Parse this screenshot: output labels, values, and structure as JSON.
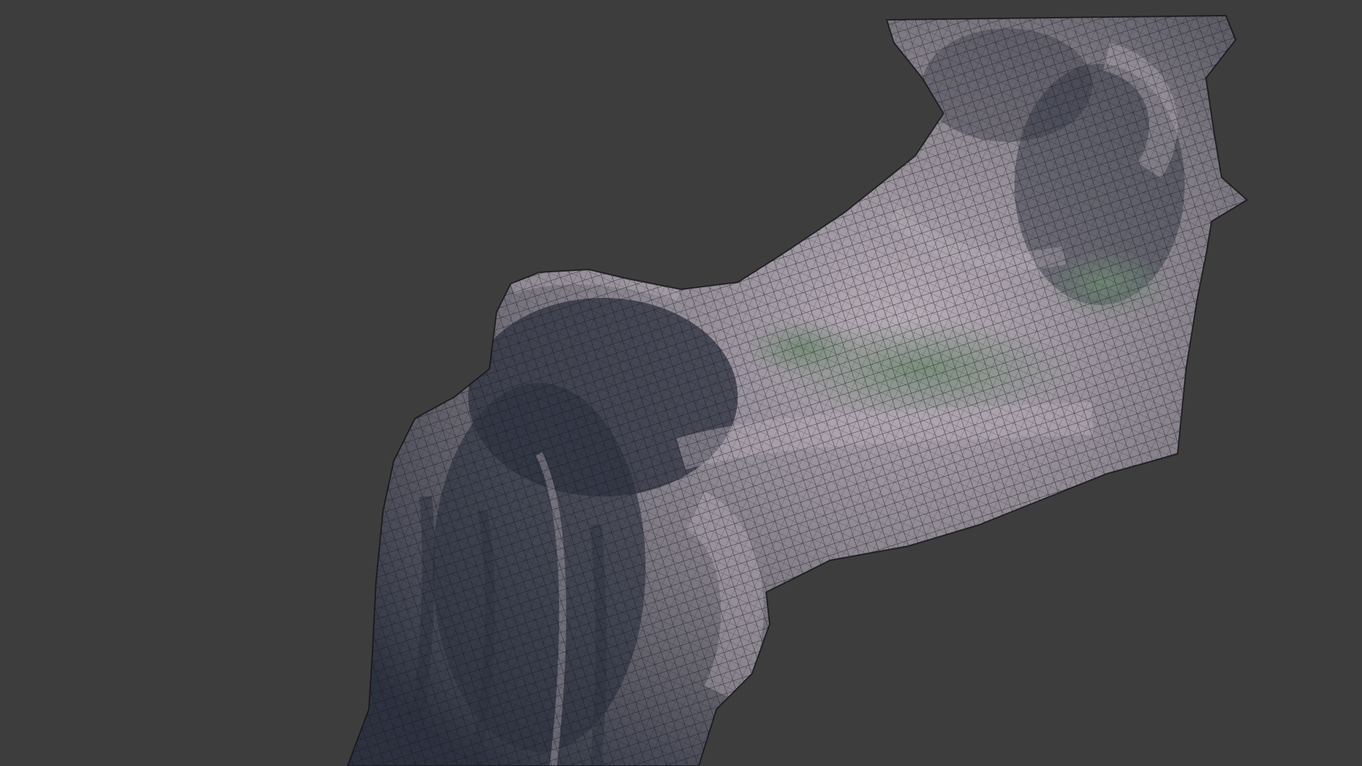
{
  "viewport": {
    "background_color": "#3d3d3d",
    "object": {
      "kind": "tree-trunk-scan-mesh",
      "display": "textured-with-wireframe-overlay",
      "base_color": "#7b7780",
      "shadow_color": "#2d3240",
      "highlight_color": "#b8aeb8",
      "moss_color": "#6f8a72",
      "wire_color": "#141418"
    }
  }
}
